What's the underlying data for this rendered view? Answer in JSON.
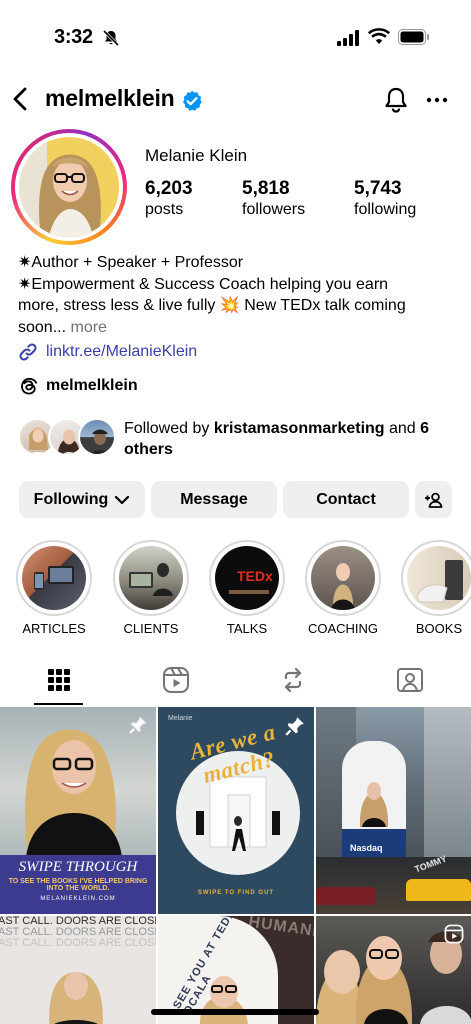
{
  "status_bar": {
    "time": "3:32"
  },
  "header": {
    "username": "melmelklein"
  },
  "profile": {
    "display_name": "Melanie Klein",
    "stats": [
      {
        "value": "6,203",
        "label": "posts"
      },
      {
        "value": "5,818",
        "label": "followers"
      },
      {
        "value": "5,743",
        "label": "following"
      }
    ],
    "bio_line1": "✷Author + Speaker + Professor",
    "bio_line2": "✷Empowerment & Success Coach helping you earn",
    "bio_line3": "more, stress less & live fully 💥 New TEDx talk coming",
    "bio_line4": "soon...",
    "bio_more": "more",
    "link": "linktr.ee/MelanieKlein",
    "threads_handle": "melmelklein",
    "followed_by_prefix": "Followed by ",
    "followed_by_name": "kristamasonmarketing",
    "followed_by_mid": " and ",
    "followed_by_others": "6 others"
  },
  "buttons": {
    "following": "Following",
    "message": "Message",
    "contact": "Contact"
  },
  "highlights": [
    {
      "label": "ARTICLES"
    },
    {
      "label": "CLIENTS"
    },
    {
      "label": "TALKS"
    },
    {
      "label": "COACHING"
    },
    {
      "label": "BOOKS"
    }
  ],
  "posts": {
    "tile1_title": "SWIPE THROUGH",
    "tile1_sub": "TO SEE THE BOOKS I'VE HELPED BRING INTO THE WORLD.",
    "tile1_url": "MELANIEKLEIN.COM",
    "tile2_brand": "Melanie",
    "tile2_title": "Are we a match?",
    "tile2_sub": "SWIPE TO FIND OUT",
    "tile3_sign": "Nasdaq",
    "tile3_brand": "TOMMY",
    "tile4_text": "AST CALL. DOORS ARE CLOSING",
    "tile5_text": "SEE YOU AT TEDX OCALA",
    "tile5_bg": "HUMANITY",
    "talks_badge": "TEDx"
  },
  "colors": {
    "accent_blue": "#0095f6",
    "link": "#3b3fa8",
    "button_bg": "#efefef"
  }
}
